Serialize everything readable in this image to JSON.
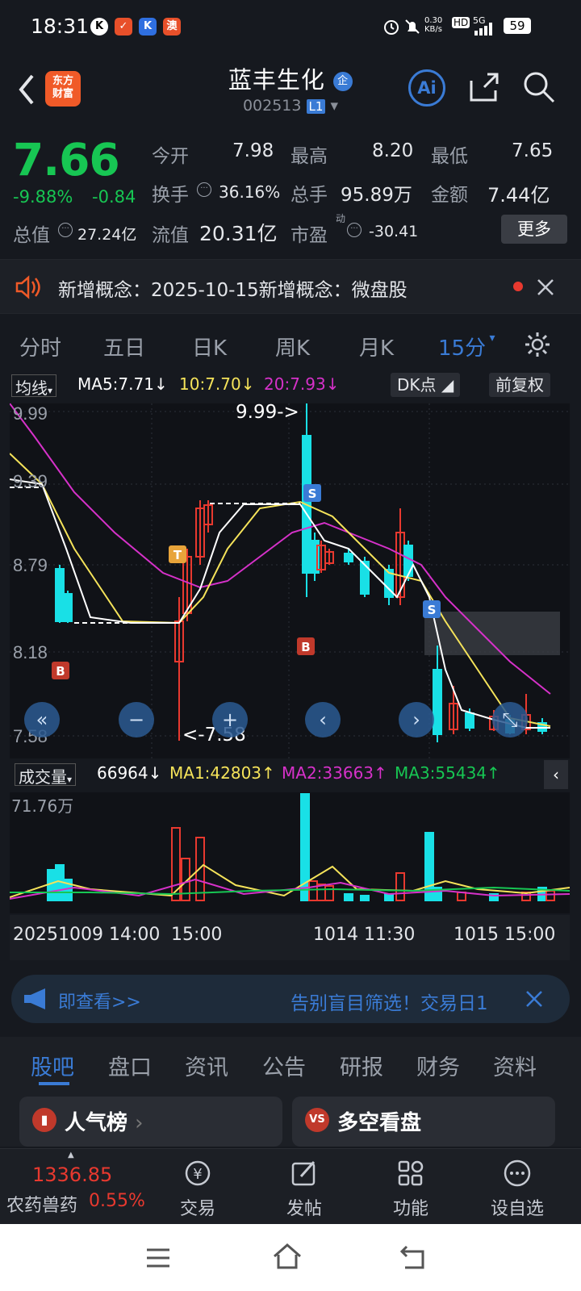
{
  "status": {
    "time": "18:31",
    "net_speed": "0.30\nKB/s",
    "hd": "HD",
    "signal": "5G",
    "battery": "59"
  },
  "header": {
    "logo_l1": "东方",
    "logo_l2": "财富",
    "name": "蓝丰生化",
    "badge": "企",
    "code": "002513",
    "level": "L1",
    "ai_label": "Ai"
  },
  "quote": {
    "price": "7.66",
    "change_pct": "-9.88%",
    "change": "-0.84",
    "open_label": "今开",
    "open": "7.98",
    "high_label": "最高",
    "high": "8.20",
    "low_label": "最低",
    "low": "7.65",
    "turnover_label": "换手",
    "turnover": "36.16%",
    "volume_label": "总手",
    "volume": "95.89万",
    "amount_label": "金额",
    "amount": "7.44亿",
    "mcap_label": "总值",
    "mcap": "27.24亿",
    "float_label": "流值",
    "float_mcap": "20.31亿",
    "pe_label": "市盈",
    "pe_sup": "动",
    "pe": "-30.41",
    "more": "更多"
  },
  "notice": {
    "text": "新增概念：2025-10-15新增概念：微盘股"
  },
  "period_tabs": [
    "分时",
    "五日",
    "日K",
    "周K",
    "月K",
    "15分"
  ],
  "chart_bar": {
    "indicator": "均线",
    "ma5": "MA5:7.71",
    "ma10": "10:7.70",
    "ma20": "20:7.93",
    "dk": "DK点",
    "adj": "前复权"
  },
  "chart": {
    "y_labels": [
      "9.99",
      "9.39",
      "8.79",
      "8.18",
      "7.58"
    ],
    "high_note": "9.99->",
    "low_note": "<-7.58",
    "markers": [
      "T",
      "S",
      "B",
      "S",
      "B"
    ]
  },
  "vol_bar": {
    "label": "成交量",
    "vol": "66964",
    "ma1": "MA1:42803",
    "ma2": "MA2:33663",
    "ma3": "MA3:55434",
    "max": "71.76万"
  },
  "time_axis": [
    "20251009 14:00",
    "15:00",
    "1014 11:30",
    "1015 15:00"
  ],
  "ad": {
    "left": "即查看>>",
    "right": "告别盲目筛选！交易日1"
  },
  "bottom_tabs": [
    "股吧",
    "盘口",
    "资讯",
    "公告",
    "研报",
    "财务",
    "资料"
  ],
  "cards": {
    "left": "人气榜",
    "right": "多空看盘"
  },
  "footer": {
    "index_value": "1336.85",
    "index_name": "农药兽药",
    "index_pct": "0.55%",
    "items": [
      "交易",
      "发帖",
      "功能",
      "设自选"
    ]
  },
  "colors": {
    "up": "#e8392f",
    "down": "#17c653",
    "ma5": "#ffffff",
    "ma10": "#f5e35a",
    "ma20": "#d631c9",
    "accent": "#3a7bd5"
  },
  "chart_data": {
    "type": "candlestick",
    "ylim": [
      7.58,
      9.99
    ],
    "ma_series": [
      "MA5",
      "MA10",
      "MA20"
    ]
  }
}
